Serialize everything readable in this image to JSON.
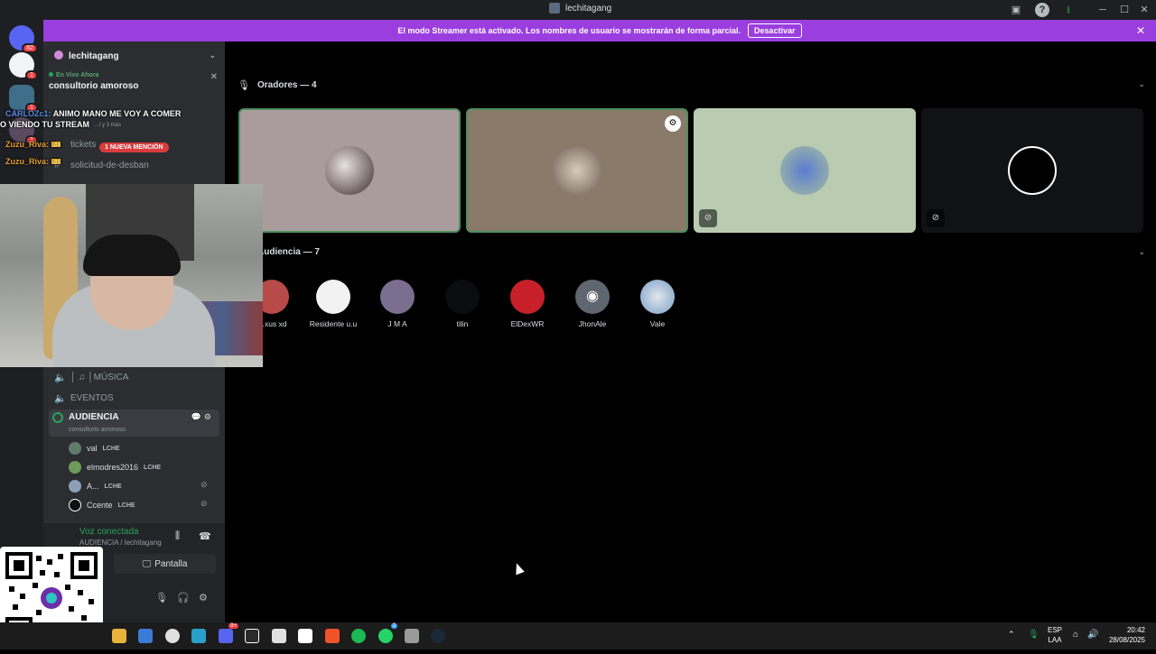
{
  "window": {
    "title": "lechitagang"
  },
  "banner": {
    "message": "El modo Streamer está activado. Los nombres de usuario se mostrarán de forma parcial.",
    "button": "Desactivar"
  },
  "servers": {
    "home_badge": "82",
    "badge_1": "1",
    "badge_2": "1",
    "badge_3": "1"
  },
  "sidebar": {
    "guild_name": "lechitagang",
    "live_label": "En Vivo Ahora",
    "live_title": "consultorio amoroso",
    "live_sub": "…l y 3 más",
    "mention_pill": "1 NUEVA MENCIÓN",
    "channel_tickets": "tickets",
    "channel_desban": "solicitud-de-desban",
    "channel_musica": "MÚSICA",
    "channel_eventos": "EVENTOS",
    "channel_audiencia": "AUDIENCIA",
    "audiencia_sub": "consultorio amoroso",
    "voice_users": [
      {
        "name": "val",
        "tag": "LCHE"
      },
      {
        "name": "elmodres2016",
        "tag": "LCHE"
      },
      {
        "name": "A...",
        "tag": "LCHE"
      },
      {
        "name": "Ccente",
        "tag": "LCHE"
      }
    ]
  },
  "panel": {
    "status": "Voz conectada",
    "location": "AUDIENCIA / lechitagang",
    "screen_button": "Pantalla"
  },
  "main": {
    "speakers_header": "Oradores — 4",
    "audience_header": "Audiencia — 7",
    "audience": [
      "…xus xd",
      "Residente u.u",
      "J M A",
      "tilin",
      "ElDexWR",
      "JhonAle",
      "Vale"
    ]
  },
  "chat": [
    {
      "user": "CARLOZc1:",
      "text": "ANIMO MANO ME VOY A COMER",
      "cont": "O VIENDO TU STREAM"
    },
    {
      "user": "Zuzu_Riva:",
      "text": "🎫"
    },
    {
      "user": "Zuzu_Riva:",
      "text": "🎫"
    }
  ],
  "taskbar": {
    "lang": "ESP",
    "lang_sub": "LAA",
    "time": "20:42",
    "date": "28/08/2025",
    "discord_badge": "9+",
    "whatsapp_badge": "2"
  },
  "colors": {
    "accent": "#9b3ee0",
    "green": "#23a55a",
    "tile1": "#aa9c9d",
    "tile2": "#8a7a69",
    "tile3": "#b9ccb2",
    "tile4": "#111214"
  }
}
